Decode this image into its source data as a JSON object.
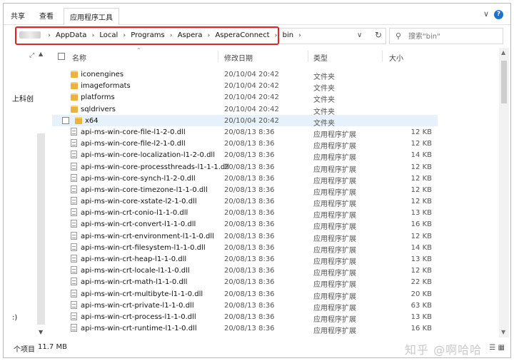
{
  "ribbon": {
    "tabs": [
      {
        "label": "共享"
      },
      {
        "label": "查看"
      },
      {
        "label": "应用程序工具"
      }
    ]
  },
  "address": {
    "crumbs": [
      "AppData",
      "Local",
      "Programs",
      "Aspera",
      "AsperaConnect",
      "bin"
    ],
    "highlight_color": "#d9272e"
  },
  "search": {
    "placeholder": "搜索\"bin\""
  },
  "nav": {
    "items": [
      {
        "label": "上科创"
      },
      {
        "label": ":)"
      }
    ]
  },
  "columns": {
    "name": "名称",
    "date": "修改日期",
    "type": "类型",
    "size": "大小"
  },
  "files": [
    {
      "name": "iconengines",
      "date": "20/10/04 20:42",
      "type": "文件夹",
      "size": "",
      "icon": "folder-icon"
    },
    {
      "name": "imageformats",
      "date": "20/10/04 20:42",
      "type": "文件夹",
      "size": "",
      "icon": "folder-icon"
    },
    {
      "name": "platforms",
      "date": "20/10/04 20:42",
      "type": "文件夹",
      "size": "",
      "icon": "folder-icon"
    },
    {
      "name": "sqldrivers",
      "date": "20/10/04 20:42",
      "type": "文件夹",
      "size": "",
      "icon": "folder-icon"
    },
    {
      "name": "x64",
      "date": "20/10/04 20:42",
      "type": "文件夹",
      "size": "",
      "icon": "folder-icon",
      "selected": true
    },
    {
      "name": "api-ms-win-core-file-l1-2-0.dll",
      "date": "20/08/13 8:36",
      "type": "应用程序扩展",
      "size": "12 KB",
      "icon": "dll-file-icon"
    },
    {
      "name": "api-ms-win-core-file-l2-1-0.dll",
      "date": "20/08/13 8:36",
      "type": "应用程序扩展",
      "size": "12 KB",
      "icon": "dll-file-icon"
    },
    {
      "name": "api-ms-win-core-localization-l1-2-0.dll",
      "date": "20/08/13 8:36",
      "type": "应用程序扩展",
      "size": "14 KB",
      "icon": "dll-file-icon"
    },
    {
      "name": "api-ms-win-core-processthreads-l1-1-1.dll",
      "date": "20/08/13 8:36",
      "type": "应用程序扩展",
      "size": "12 KB",
      "icon": "dll-file-icon"
    },
    {
      "name": "api-ms-win-core-synch-l1-2-0.dll",
      "date": "20/08/13 8:36",
      "type": "应用程序扩展",
      "size": "12 KB",
      "icon": "dll-file-icon"
    },
    {
      "name": "api-ms-win-core-timezone-l1-1-0.dll",
      "date": "20/08/13 8:36",
      "type": "应用程序扩展",
      "size": "12 KB",
      "icon": "dll-file-icon"
    },
    {
      "name": "api-ms-win-core-xstate-l2-1-0.dll",
      "date": "20/08/13 8:36",
      "type": "应用程序扩展",
      "size": "12 KB",
      "icon": "dll-file-icon"
    },
    {
      "name": "api-ms-win-crt-conio-l1-1-0.dll",
      "date": "20/08/13 8:36",
      "type": "应用程序扩展",
      "size": "13 KB",
      "icon": "dll-file-icon"
    },
    {
      "name": "api-ms-win-crt-convert-l1-1-0.dll",
      "date": "20/08/13 8:36",
      "type": "应用程序扩展",
      "size": "16 KB",
      "icon": "dll-file-icon"
    },
    {
      "name": "api-ms-win-crt-environment-l1-1-0.dll",
      "date": "20/08/13 8:36",
      "type": "应用程序扩展",
      "size": "12 KB",
      "icon": "dll-file-icon"
    },
    {
      "name": "api-ms-win-crt-filesystem-l1-1-0.dll",
      "date": "20/08/13 8:36",
      "type": "应用程序扩展",
      "size": "14 KB",
      "icon": "dll-file-icon"
    },
    {
      "name": "api-ms-win-crt-heap-l1-1-0.dll",
      "date": "20/08/13 8:36",
      "type": "应用程序扩展",
      "size": "13 KB",
      "icon": "dll-file-icon"
    },
    {
      "name": "api-ms-win-crt-locale-l1-1-0.dll",
      "date": "20/08/13 8:36",
      "type": "应用程序扩展",
      "size": "12 KB",
      "icon": "dll-file-icon"
    },
    {
      "name": "api-ms-win-crt-math-l1-1-0.dll",
      "date": "20/08/13 8:36",
      "type": "应用程序扩展",
      "size": "22 KB",
      "icon": "dll-file-icon"
    },
    {
      "name": "api-ms-win-crt-multibyte-l1-1-0.dll",
      "date": "20/08/13 8:36",
      "type": "应用程序扩展",
      "size": "20 KB",
      "icon": "dll-file-icon"
    },
    {
      "name": "api-ms-win-crt-private-l1-1-0.dll",
      "date": "20/08/13 8:36",
      "type": "应用程序扩展",
      "size": "63 KB",
      "icon": "dll-file-icon"
    },
    {
      "name": "api-ms-win-crt-process-l1-1-0.dll",
      "date": "20/08/13 8:36",
      "type": "应用程序扩展",
      "size": "13 KB",
      "icon": "dll-file-icon"
    },
    {
      "name": "api-ms-win-crt-runtime-l1-1-0.dll",
      "date": "20/08/13 8:36",
      "type": "应用程序扩展",
      "size": "16 KB",
      "icon": "dll-file-icon"
    }
  ],
  "status": {
    "count": "个项目",
    "size": "11.7 MB"
  },
  "watermark": "知乎 @啊哈哈"
}
